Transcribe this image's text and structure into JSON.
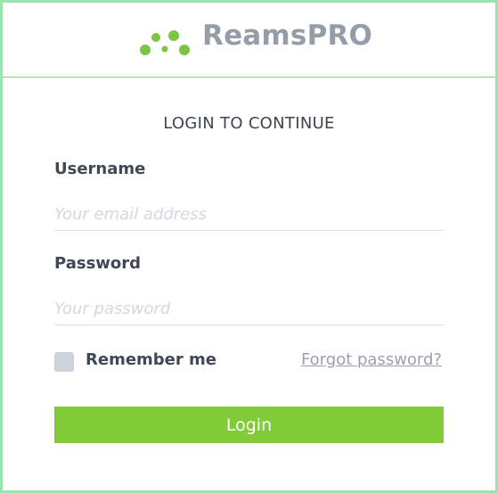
{
  "brand": {
    "name": "ReamsPRO",
    "logo_icon": "green-dots-logo",
    "logo_color": "#7cc544"
  },
  "form": {
    "heading": "LOGIN TO CONTINUE",
    "username": {
      "label": "Username",
      "placeholder": "Your email address",
      "value": ""
    },
    "password": {
      "label": "Password",
      "placeholder": "Your password",
      "value": ""
    },
    "remember_label": "Remember me",
    "remember_checked": false,
    "forgot_label": "Forgot password?",
    "submit_label": "Login"
  },
  "colors": {
    "accent": "#80cc38",
    "frame_border": "#9be3b0",
    "header_divider": "#7ccf6b",
    "text": "#3f4854",
    "muted": "#9aa1aa"
  }
}
